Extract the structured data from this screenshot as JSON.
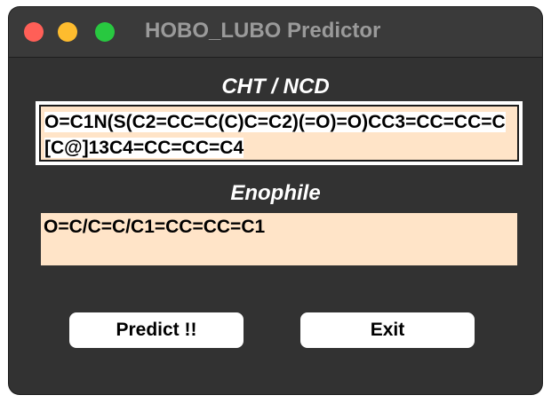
{
  "window": {
    "title": "HOBO_LUBO Predictor"
  },
  "cht": {
    "label": "CHT / NCD",
    "value": "O=C1N(S(C2=CC=C(C)C=C2)(=O)=O)CC3=CC=CC=C[C@]13C4=CC=CC=C4"
  },
  "enophile": {
    "label": "Enophile",
    "value": "O=C/C=C/C1=CC=CC=C1"
  },
  "buttons": {
    "predict_label": "Predict !!",
    "exit_label": "Exit"
  },
  "colors": {
    "window_bg": "#323232",
    "field_bg": "#ffe4c8",
    "close": "#ff5f57",
    "minimize": "#febc2e",
    "zoom": "#28c840"
  }
}
